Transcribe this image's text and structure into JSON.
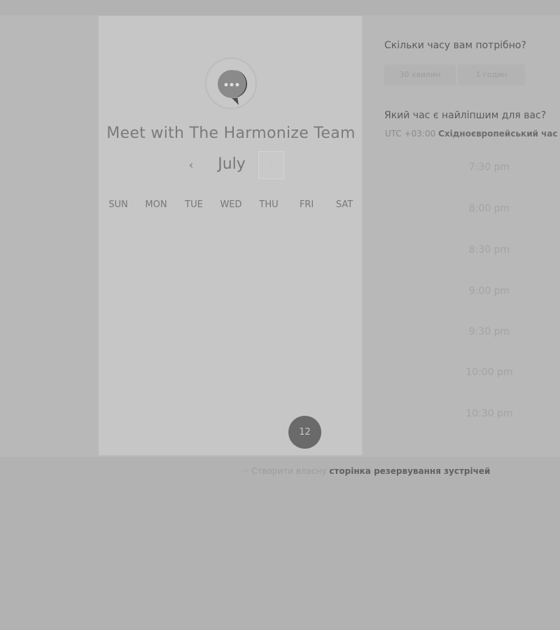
{
  "card": {
    "logo": "chat-bubble-logo",
    "title": "Meet with The Harmonize Team",
    "month": "July",
    "prev_icon": "‹",
    "next_icon": "›",
    "weekdays": [
      "SUN",
      "MON",
      "TUE",
      "WED",
      "THU",
      "FRI",
      "SAT"
    ],
    "selected_day": "12"
  },
  "panel": {
    "duration_question": "Скільки часу вам потрібно?",
    "durations": [
      "30 хвилин",
      "1 годин"
    ],
    "time_question": "Який час є найліпшим для вас?",
    "timezone_offset": "UTC +03:00",
    "timezone_name": "Східноєвропейський час",
    "slots": [
      "7:30 pm",
      "8:00 pm",
      "8:30 pm",
      "9:00 pm",
      "9:30 pm",
      "10:00 pm",
      "10:30 pm"
    ]
  },
  "footer": {
    "icon": "sparkle-icon",
    "prefix": "Створити власну",
    "link": "сторінка резервування зустрічей"
  },
  "colors": {
    "selected_day_bg": "#6a6a6a",
    "page_bg": "#b2b2b2",
    "card_bg": "#c6c6c6"
  }
}
